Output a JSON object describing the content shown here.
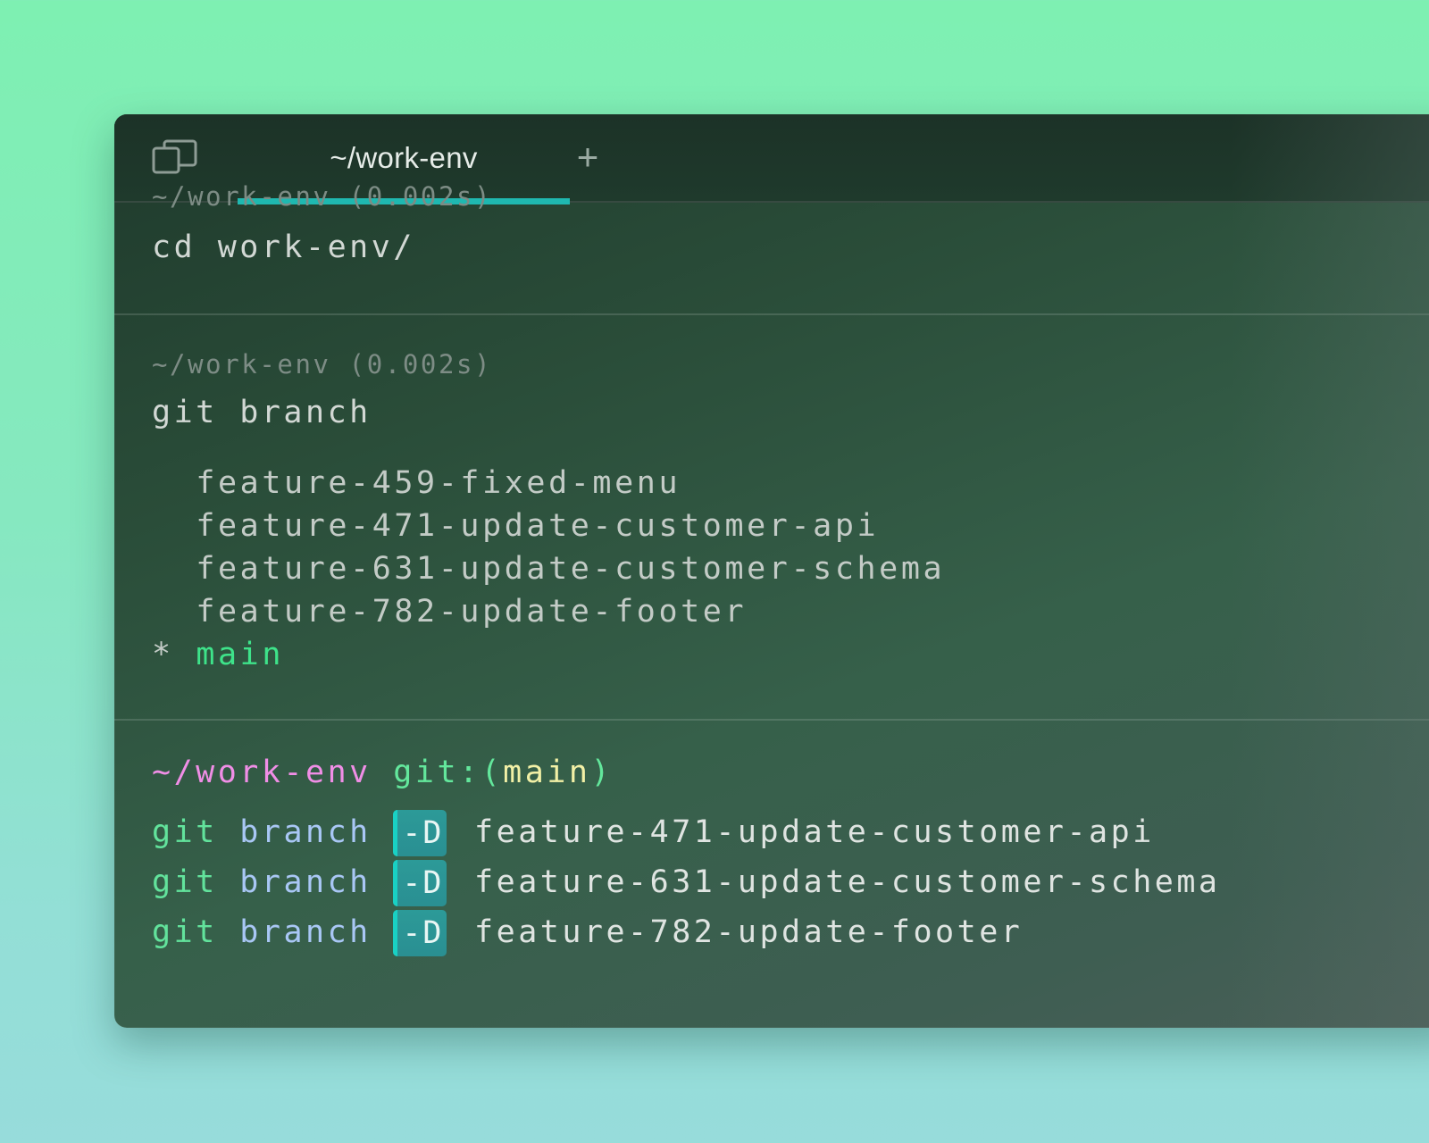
{
  "window": {
    "tab_label": "~/work-env",
    "new_tab_symbol": "+",
    "panel_toggle_icon": "split-panel-icon",
    "accent_color": "#1fb8b0"
  },
  "blocks": [
    {
      "meta": "~/work-env (0.002s)",
      "command": "cd work-env/"
    },
    {
      "meta": "~/work-env (0.002s)",
      "command": "git branch",
      "output": [
        {
          "marker": " ",
          "name": "feature-459-fixed-menu",
          "current": false
        },
        {
          "marker": " ",
          "name": "feature-471-update-customer-api",
          "current": false
        },
        {
          "marker": " ",
          "name": "feature-631-update-customer-schema",
          "current": false
        },
        {
          "marker": " ",
          "name": "feature-782-update-footer",
          "current": false
        },
        {
          "marker": "*",
          "name": "main",
          "current": true
        }
      ]
    }
  ],
  "prompt": {
    "path": "~/work-env",
    "git_label": "git:",
    "open_paren": "(",
    "branch": "main",
    "close_paren": ")"
  },
  "input_lines": [
    {
      "cmd": "git",
      "sub": "branch",
      "flag": "-D",
      "target": "feature-471-update-customer-api"
    },
    {
      "cmd": "git",
      "sub": "branch",
      "flag": "-D",
      "target": "feature-631-update-customer-schema"
    },
    {
      "cmd": "git",
      "sub": "branch",
      "flag": "-D",
      "target": "feature-782-update-footer"
    }
  ]
}
